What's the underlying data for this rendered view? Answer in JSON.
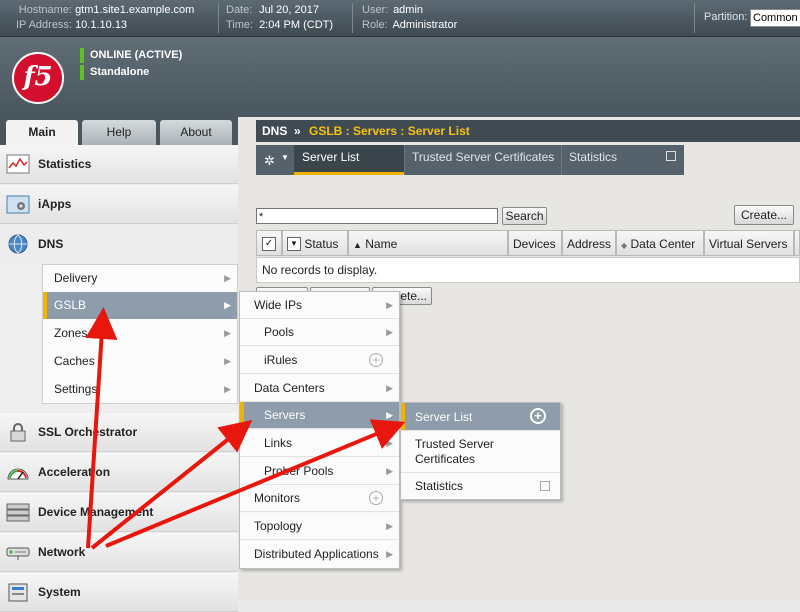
{
  "topbar": {
    "hostname_label": "Hostname:",
    "hostname": "gtm1.site1.example.com",
    "ip_label": "IP Address:",
    "ip": "10.1.10.13",
    "date_label": "Date:",
    "date": "Jul 20, 2017",
    "time_label": "Time:",
    "time": "2:04 PM (CDT)",
    "user_label": "User:",
    "user": "admin",
    "role_label": "Role:",
    "role": "Administrator",
    "partition_label": "Partition:",
    "partition_value": "Common"
  },
  "header": {
    "logo_text": "f5",
    "status_primary": "ONLINE (ACTIVE)",
    "status_secondary": "Standalone",
    "status_color": "#5fc11f"
  },
  "main_tabs": [
    {
      "label": "Main",
      "active": true
    },
    {
      "label": "Help",
      "active": false
    },
    {
      "label": "About",
      "active": false
    }
  ],
  "nav": {
    "sections": [
      {
        "label": "Statistics",
        "icon": "statistics-icon"
      },
      {
        "label": "iApps",
        "icon": "iapps-icon"
      },
      {
        "label": "DNS",
        "icon": "globe-icon"
      },
      {
        "label": "SSL Orchestrator",
        "icon": "lock-icon"
      },
      {
        "label": "Acceleration",
        "icon": "gauge-icon"
      },
      {
        "label": "Device Management",
        "icon": "server-icon"
      },
      {
        "label": "Network",
        "icon": "network-icon"
      },
      {
        "label": "System",
        "icon": "system-icon"
      }
    ],
    "dns_items": [
      {
        "label": "Delivery"
      },
      {
        "label": "GSLB",
        "selected": true
      },
      {
        "label": "Zones"
      },
      {
        "label": "Caches"
      },
      {
        "label": "Settings"
      }
    ]
  },
  "breadcrumb": {
    "root": "DNS",
    "separator": "»",
    "path": "GSLB : Servers : Server List"
  },
  "subtabs": [
    {
      "label": "Server List",
      "active": true
    },
    {
      "label": "Trusted Server Certificates"
    },
    {
      "label": "Statistics"
    }
  ],
  "search": {
    "value": "*",
    "button": "Search"
  },
  "create_button": "Create...",
  "table": {
    "columns": [
      "Status",
      "Name",
      "Devices",
      "Address",
      "Data Center",
      "Virtual Servers"
    ],
    "empty_text": "No records to display."
  },
  "hidden_button_fragment": "ete...",
  "gslb_menu": [
    {
      "label": "Wide IPs",
      "type": "arrow"
    },
    {
      "label": "Pools",
      "type": "arrow",
      "indent": true
    },
    {
      "label": "iRules",
      "type": "plus",
      "indent": true
    },
    {
      "label": "Data Centers",
      "type": "arrow"
    },
    {
      "label": "Servers",
      "type": "arrow",
      "selected": true,
      "indent": true
    },
    {
      "label": "Links",
      "type": "arrow",
      "indent": true
    },
    {
      "label": "Prober Pools",
      "type": "arrow",
      "indent": true
    },
    {
      "label": "Monitors",
      "type": "plus"
    },
    {
      "label": "Topology",
      "type": "arrow"
    },
    {
      "label": "Distributed Applications",
      "type": "arrow"
    }
  ],
  "servers_menu": [
    {
      "label": "Server List",
      "selected": true
    },
    {
      "label": "Trusted Server Certificates"
    },
    {
      "label": "Statistics"
    }
  ],
  "colors": {
    "accent": "#f0b400",
    "selected_bg": "#8e9cac",
    "arrow_red": "#e8160c"
  }
}
